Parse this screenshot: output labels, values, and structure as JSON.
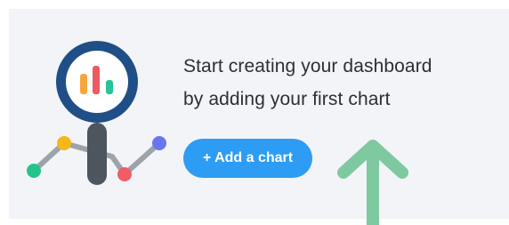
{
  "empty_state": {
    "headline_line1": "Start creating your dashboard",
    "headline_line2": "by adding your first chart",
    "add_button_label": "+ Add a chart"
  },
  "illustration": {
    "icon": "magnifier-chart-icon",
    "colors": {
      "lens_ring": "#1f4f86",
      "handle": "#4d555f",
      "bar_orange": "#f7a63b",
      "bar_red": "#ef5a62",
      "bar_teal": "#26c49b",
      "dot_teal": "#23c489",
      "dot_yellow": "#f6b71a",
      "dot_red": "#f25c66",
      "dot_purple": "#6876f2",
      "line": "#9da3ab"
    }
  },
  "hint_arrow": {
    "icon": "up-arrow-icon",
    "color": "#7fc9a0"
  },
  "theme": {
    "panel_background": "#f3f4f8",
    "accent": "#2d9cf5"
  }
}
